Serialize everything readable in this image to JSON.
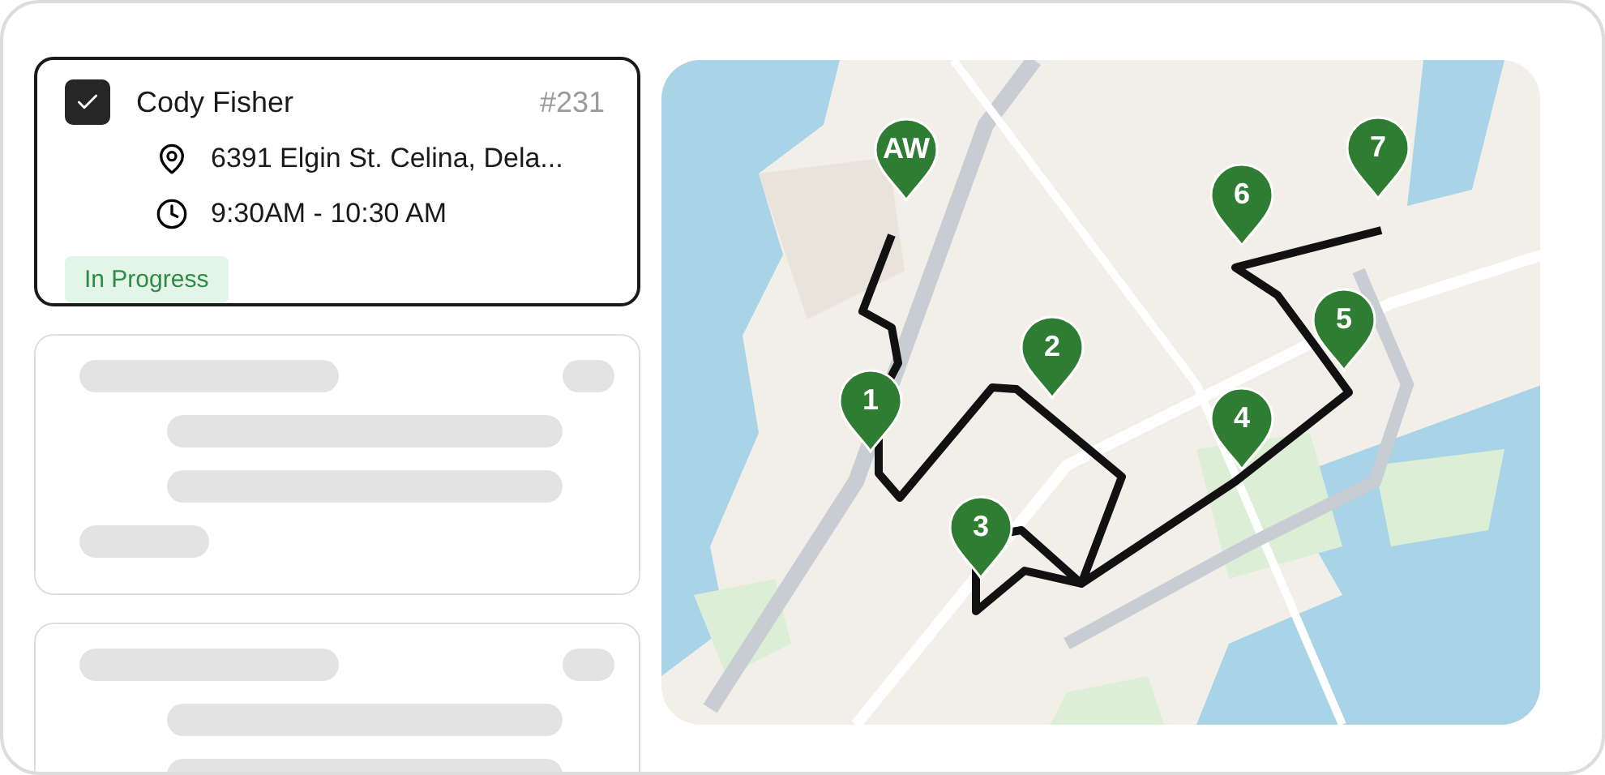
{
  "jobs": [
    {
      "kind": "job",
      "checked": true,
      "name": "Cody Fisher",
      "number": "#231",
      "address": "6391 Elgin St. Celina, Dela...",
      "time": "9:30AM - 10:30 AM",
      "status": "In Progress"
    },
    {
      "kind": "placeholder",
      "bars": [
        {
          "kind": "head"
        },
        {
          "kind": "long"
        },
        {
          "kind": "long"
        },
        {
          "kind": "short"
        }
      ]
    },
    {
      "kind": "placeholder",
      "bars": [
        {
          "kind": "head"
        },
        {
          "kind": "long"
        },
        {
          "kind": "long"
        }
      ]
    }
  ],
  "map": {
    "kind": "picture",
    "stops": [
      {
        "label": "AW"
      },
      {
        "label": "1"
      },
      {
        "label": "2"
      },
      {
        "label": "3"
      },
      {
        "label": "4"
      },
      {
        "label": "5"
      },
      {
        "label": "6"
      },
      {
        "label": "7"
      }
    ]
  }
}
